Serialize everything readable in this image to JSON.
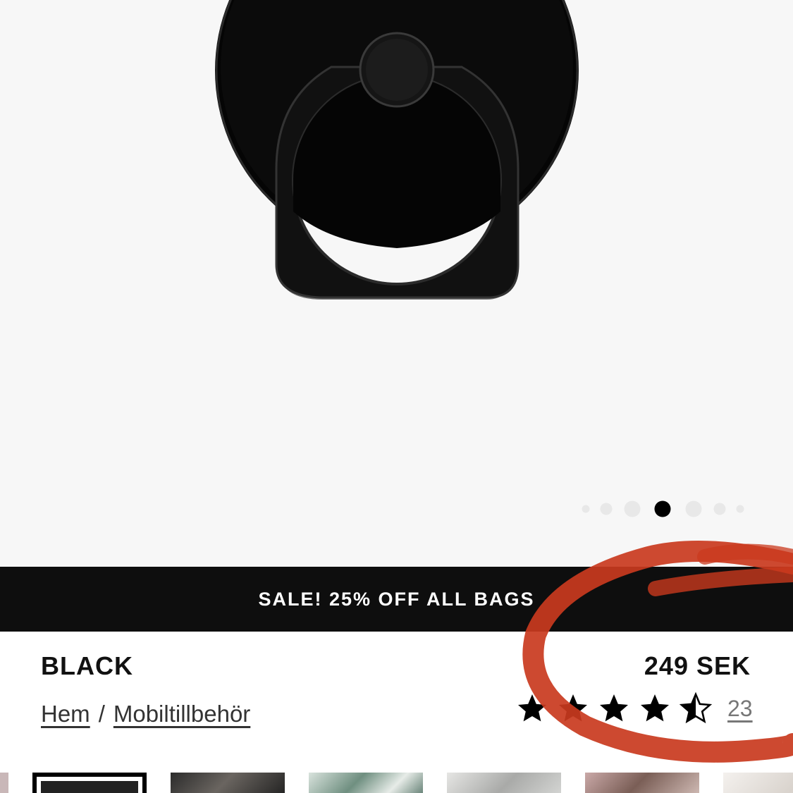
{
  "promo_banner": {
    "text": "SALE! 25% OFF ALL BAGS"
  },
  "product": {
    "title": "BLACK",
    "price": "249 SEK",
    "rating": 4.5,
    "rating_max": 5,
    "review_count": "23"
  },
  "breadcrumb": {
    "items": [
      "Hem",
      "Mobiltillbehör"
    ],
    "separator": "/"
  },
  "carousel": {
    "dot_count": 7,
    "active_index": 3
  },
  "colors": {
    "banner_bg": "#0e0e0e",
    "hero_bg": "#f7f7f7",
    "annotation_red": "#c9391e",
    "product_black": "#0a0a0a"
  }
}
